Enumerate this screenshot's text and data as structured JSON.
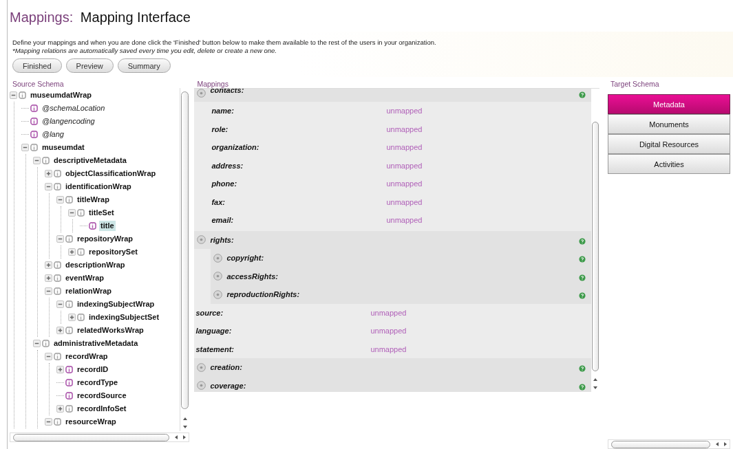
{
  "header": {
    "section": "Mappings:",
    "title": "Mapping Interface"
  },
  "intro": {
    "line_1": "Define your mappings and when you are done click the 'Finished' button below to make them available to the rest of the users in your organization.",
    "line_2": "*Mapping relations are automatically saved every time you edit, delete or create a new one."
  },
  "buttons": [
    "Finished",
    "Preview",
    "Summary"
  ],
  "source_schema": {
    "title": "Source Schema",
    "tree": [
      {
        "label": "museumdatWrap",
        "kind": "element",
        "expanded": true,
        "selected": false,
        "children": [
          {
            "label": "@schemaLocation",
            "kind": "attribute",
            "color": "#b05fb0",
            "selected": false
          },
          {
            "label": "@langencoding",
            "kind": "attribute",
            "color": "#b05fb0",
            "selected": false
          },
          {
            "label": "@lang",
            "kind": "attribute",
            "color": "#b05fb0",
            "selected": false
          },
          {
            "label": "museumdat",
            "kind": "element",
            "expanded": true,
            "selected": false,
            "children": [
              {
                "label": "descriptiveMetadata",
                "kind": "element",
                "expanded": true,
                "selected": false,
                "children": [
                  {
                    "label": "objectClassificationWrap",
                    "kind": "element",
                    "expanded": false,
                    "selected": false
                  },
                  {
                    "label": "identificationWrap",
                    "kind": "element",
                    "expanded": true,
                    "selected": false,
                    "children": [
                      {
                        "label": "titleWrap",
                        "kind": "element",
                        "expanded": true,
                        "selected": false,
                        "children": [
                          {
                            "label": "titleSet",
                            "kind": "element",
                            "expanded": true,
                            "selected": false,
                            "children": [
                              {
                                "label": "title",
                                "kind": "element",
                                "color": "#b05fb0",
                                "selected": true
                              }
                            ]
                          }
                        ]
                      },
                      {
                        "label": "repositoryWrap",
                        "kind": "element",
                        "expanded": true,
                        "selected": false,
                        "children": [
                          {
                            "label": "repositorySet",
                            "kind": "element",
                            "expanded": false,
                            "selected": false
                          }
                        ]
                      }
                    ]
                  },
                  {
                    "label": "descriptionWrap",
                    "kind": "element",
                    "expanded": false,
                    "selected": false
                  },
                  {
                    "label": "eventWrap",
                    "kind": "element",
                    "expanded": false,
                    "selected": false
                  },
                  {
                    "label": "relationWrap",
                    "kind": "element",
                    "expanded": true,
                    "selected": false,
                    "children": [
                      {
                        "label": "indexingSubjectWrap",
                        "kind": "element",
                        "expanded": true,
                        "selected": false,
                        "children": [
                          {
                            "label": "indexingSubjectSet",
                            "kind": "element",
                            "expanded": false,
                            "selected": false
                          }
                        ]
                      },
                      {
                        "label": "relatedWorksWrap",
                        "kind": "element",
                        "expanded": false,
                        "selected": false
                      }
                    ]
                  }
                ]
              },
              {
                "label": "administrativeMetadata",
                "kind": "element",
                "expanded": true,
                "selected": false,
                "children": [
                  {
                    "label": "recordWrap",
                    "kind": "element",
                    "expanded": true,
                    "selected": false,
                    "children": [
                      {
                        "label": "recordID",
                        "kind": "element",
                        "color": "#b05fb0",
                        "expanded": false,
                        "selected": false
                      },
                      {
                        "label": "recordType",
                        "kind": "element",
                        "color": "#b05fb0",
                        "selected": false
                      },
                      {
                        "label": "recordSource",
                        "kind": "element",
                        "color": "#b05fb0",
                        "selected": false
                      },
                      {
                        "label": "recordInfoSet",
                        "kind": "element",
                        "expanded": false,
                        "selected": false
                      }
                    ]
                  },
                  {
                    "label": "resourceWrap",
                    "kind": "element",
                    "expanded": true,
                    "selected": false
                  }
                ]
              }
            ]
          }
        ]
      }
    ]
  },
  "mappings": {
    "title": "Mappings",
    "items": [
      {
        "kind": "group",
        "label": "contacts:",
        "children": [
          {
            "kind": "field",
            "label": "name:",
            "value": "unmapped"
          },
          {
            "kind": "field",
            "label": "role:",
            "value": "unmapped"
          },
          {
            "kind": "field",
            "label": "organization:",
            "value": "unmapped"
          },
          {
            "kind": "field",
            "label": "address:",
            "value": "unmapped"
          },
          {
            "kind": "field",
            "label": "phone:",
            "value": "unmapped"
          },
          {
            "kind": "field",
            "label": "fax:",
            "value": "unmapped"
          },
          {
            "kind": "field",
            "label": "email:",
            "value": "unmapped"
          }
        ]
      },
      {
        "kind": "group",
        "label": "rights:",
        "children": [
          {
            "kind": "group",
            "label": "copyright:"
          },
          {
            "kind": "group",
            "label": "accessRights:"
          },
          {
            "kind": "group",
            "label": "reproductionRights:"
          }
        ]
      },
      {
        "kind": "field",
        "label": "source:",
        "value": "unmapped"
      },
      {
        "kind": "field",
        "label": "language:",
        "value": "unmapped"
      },
      {
        "kind": "field",
        "label": "statement:",
        "value": "unmapped"
      },
      {
        "kind": "group",
        "label": "creation:"
      },
      {
        "kind": "group",
        "label": "coverage:"
      }
    ]
  },
  "target_schema": {
    "title": "Target Schema",
    "tabs": [
      {
        "label": "Metadata",
        "selected": true
      },
      {
        "label": "Monuments",
        "selected": false
      },
      {
        "label": "Digital Resources",
        "selected": false
      },
      {
        "label": "Activities",
        "selected": false
      }
    ]
  }
}
